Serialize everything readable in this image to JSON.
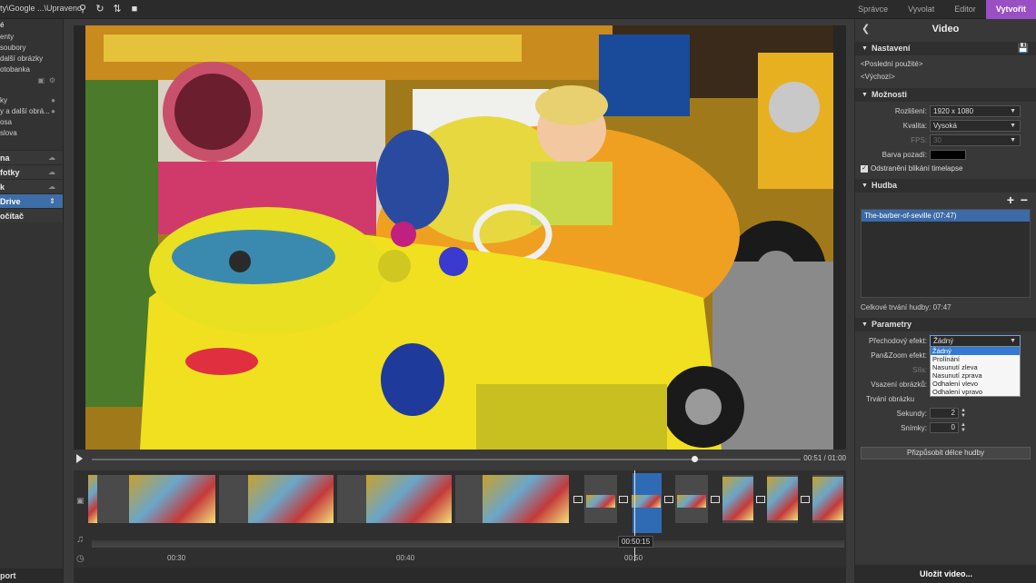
{
  "topbar": {
    "path": "ty\\Google ...\\Upraveno",
    "modes": [
      "Správce",
      "Vyvolat",
      "Editor",
      "Vytvořit"
    ],
    "active_mode": "Vytvořit"
  },
  "sidebar": {
    "items1": [
      "é",
      "enty",
      "soubory",
      "další obrázky",
      "otobanka"
    ],
    "items2": [
      "ky",
      "y a další obrá...",
      "osa",
      "slova"
    ],
    "sections": [
      "na",
      "fotky",
      "k",
      "Drive",
      "očítač"
    ],
    "selected": "Drive",
    "bottom": "port"
  },
  "player": {
    "time": "00:51 / 01:00",
    "progress": 0.85
  },
  "timeline": {
    "playhead_label": "00:50:15",
    "ticks": [
      "00:30",
      "00:40",
      "00:50"
    ]
  },
  "panel": {
    "title": "Video",
    "nastaveni": {
      "label": "Nastavení",
      "links": [
        "<Poslední použité>",
        "<Výchozí>"
      ]
    },
    "moznosti": {
      "label": "Možnosti",
      "resolution_label": "Rozlišení:",
      "resolution_value": "1920 x 1080",
      "quality_label": "Kvalita:",
      "quality_value": "Vysoká",
      "fps_label": "FPS:",
      "fps_value": "30",
      "bg_label": "Barva pozadí:",
      "bg_color": "#000000",
      "flicker_label": "Odstranění blikání timelapse"
    },
    "hudba": {
      "label": "Hudba",
      "tracks": [
        "The-barber-of-seville (07:47)"
      ],
      "total": "Celkové trvání hudby: 07:47"
    },
    "parametry": {
      "label": "Parametry",
      "transition_label": "Přechodový efekt:",
      "transition_value": "Žádný",
      "transition_options": [
        "Žádný",
        "Prolínání",
        "Nasunutí zleva",
        "Nasunutí zprava",
        "Odhalení vlevo",
        "Odhalení vpravo"
      ],
      "panzoom_label": "Pan&Zoom efekt:",
      "sila_label": "Síla:",
      "vsazeni_label": "Vsazení obrázků:",
      "trvani_label": "Trvání obrázku",
      "sekundy_label": "Sekundy:",
      "sekundy_value": "2",
      "snimky_label": "Snímky:",
      "snimky_value": "0",
      "fit_button": "Přizpůsobit délce hudby"
    },
    "save_button": "Uložit video..."
  }
}
